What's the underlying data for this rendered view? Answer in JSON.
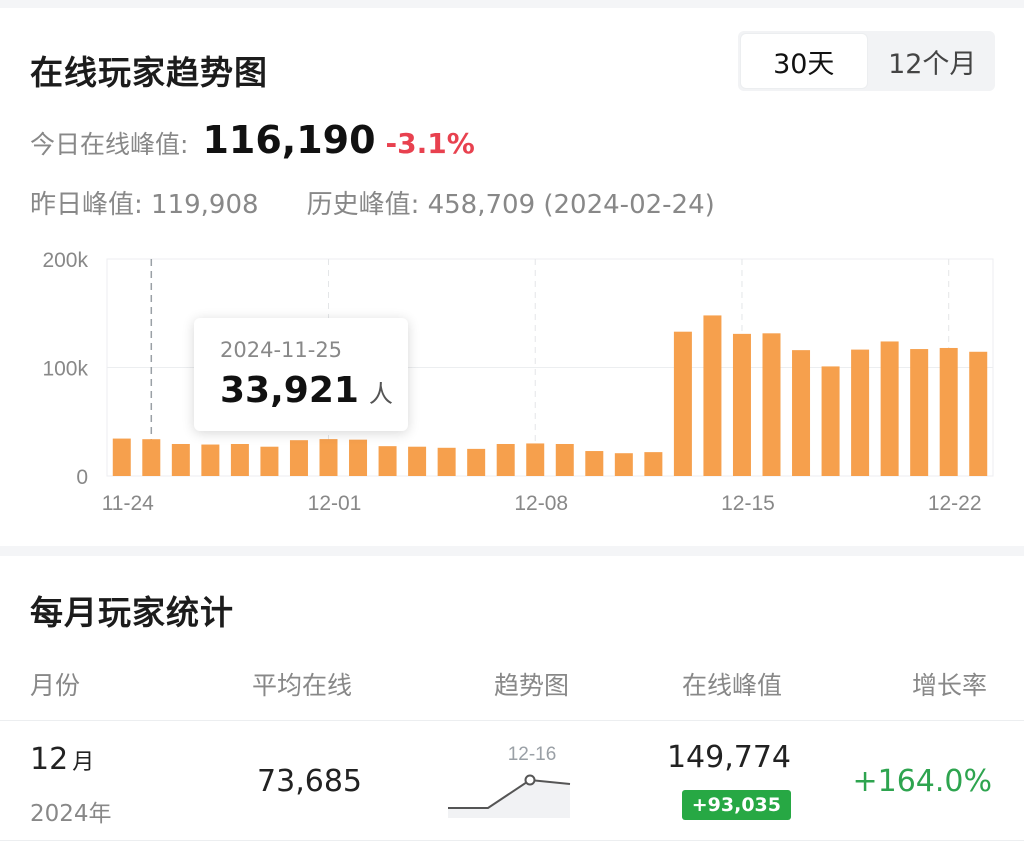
{
  "trend": {
    "title": "在线玩家趋势图",
    "range_tabs": [
      "30天",
      "12个月"
    ],
    "active_range": "30天",
    "today_peak_label": "今日在线峰值:",
    "today_peak_value": "116,190",
    "today_peak_change": "-3.1%",
    "yesterday_peak_label": "昨日峰值:",
    "yesterday_peak_value": "119,908",
    "history_peak_label": "历史峰值:",
    "history_peak_value": "458,709 (2024-02-24)",
    "tooltip": {
      "date": "2024-11-25",
      "value": "33,921",
      "unit": "人"
    }
  },
  "chart_data": {
    "type": "bar",
    "categories": [
      "11-24",
      "11-25",
      "11-26",
      "11-27",
      "11-28",
      "11-29",
      "11-30",
      "12-01",
      "12-02",
      "12-03",
      "12-04",
      "12-05",
      "12-06",
      "12-07",
      "12-08",
      "12-09",
      "12-10",
      "12-11",
      "12-12",
      "12-13",
      "12-14",
      "12-15",
      "12-16",
      "12-17",
      "12-18",
      "12-19",
      "12-20",
      "12-21",
      "12-22",
      "12-23"
    ],
    "values": [
      34500,
      33921,
      29500,
      29000,
      29500,
      27000,
      33000,
      34000,
      33500,
      27500,
      27000,
      26000,
      25000,
      29500,
      30000,
      29500,
      23000,
      21000,
      22000,
      133000,
      148000,
      131000,
      131500,
      116000,
      101000,
      116500,
      124000,
      117000,
      118000,
      114500
    ],
    "yticks": [
      "0",
      "100k",
      "200k"
    ],
    "ylim": [
      0,
      200000
    ],
    "xticks": [
      "11-24",
      "12-01",
      "12-08",
      "12-15",
      "12-22"
    ],
    "highlight": "11-25",
    "bar_color": "#f6a04d",
    "grid": true
  },
  "monthly": {
    "title": "每月玩家统计",
    "headers": {
      "month": "月份",
      "avg": "平均在线",
      "trend": "趋势图",
      "peak": "在线峰值",
      "growth": "增长率"
    },
    "rows": [
      {
        "month_num": "12",
        "month_unit": "月",
        "year": "2024年",
        "avg": "73,685",
        "spark_label": "12-16",
        "peak": "149,774",
        "peak_delta": "+93,035",
        "growth": "+164.0%"
      }
    ]
  }
}
